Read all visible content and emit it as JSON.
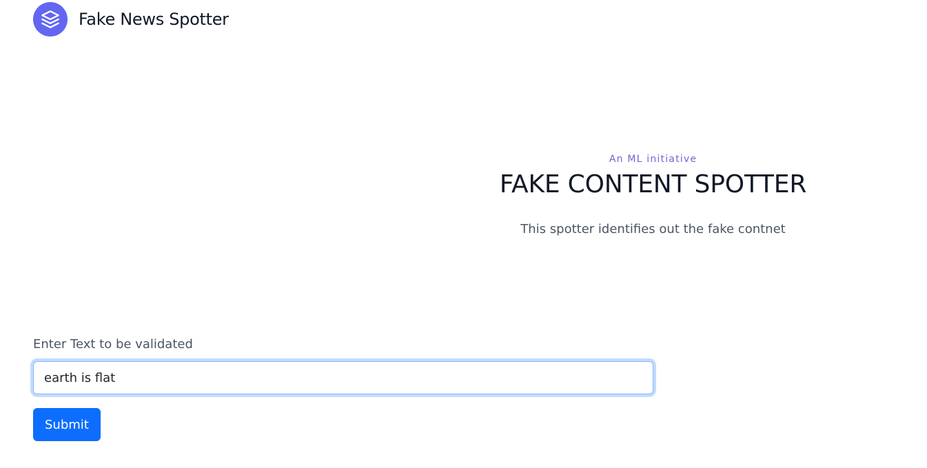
{
  "header": {
    "brand_name": "Fake News Spotter",
    "logo_icon": "layers-icon",
    "logo_color": "#6366f1"
  },
  "hero": {
    "tagline": "An ML initiative",
    "title": "FAKE CONTENT SPOTTER",
    "description": "This spotter identifies out the fake contnet"
  },
  "form": {
    "label": "Enter Text to be validated",
    "input_value": "earth is flat",
    "submit_label": "Submit"
  },
  "colors": {
    "accent": "#7c5fd6",
    "button": "#0d6efd"
  }
}
